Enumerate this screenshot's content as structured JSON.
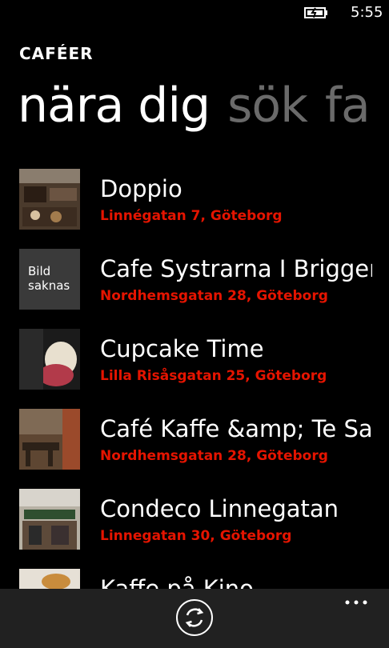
{
  "status": {
    "time": "5:55",
    "battery_icon": "battery-charging-icon"
  },
  "app": {
    "title": "CAFÉER"
  },
  "pivot": {
    "items": [
      "nära dig",
      "sök",
      "fa"
    ],
    "active_index": 0
  },
  "cafes": [
    {
      "name": "Doppio",
      "address": "Linnégatan 7, Göteborg",
      "thumbnail": "photo"
    },
    {
      "name": "Cafe Systrarna I Briggen",
      "address": "Nordhemsgatan 28, Göteborg",
      "thumbnail": "missing",
      "missing_text": "Bild saknas"
    },
    {
      "name": "Cupcake Time",
      "address": "Lilla Risåsgatan 25, Göteborg",
      "thumbnail": "photo"
    },
    {
      "name": "Café Kaffe &amp; Te Salu",
      "address": "Nordhemsgatan 28, Göteborg",
      "thumbnail": "photo"
    },
    {
      "name": "Condeco Linnegatan",
      "address": "Linnegatan 30, Göteborg",
      "thumbnail": "photo"
    },
    {
      "name": "Kaffe på Kino",
      "address": "",
      "thumbnail": "photo"
    }
  ],
  "app_bar": {
    "refresh_icon": "refresh-icon",
    "more_icon": "more-icon"
  },
  "colors": {
    "accent": "#e51400",
    "background": "#000000",
    "app_bar": "#212121"
  }
}
